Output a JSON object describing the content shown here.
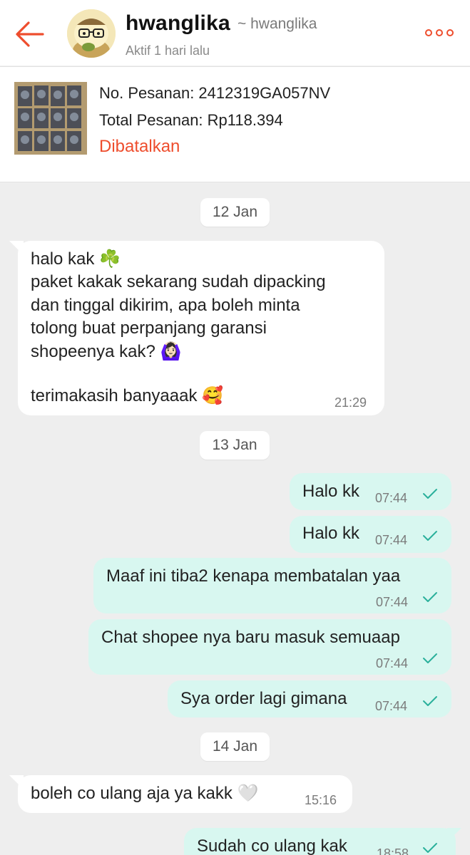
{
  "header": {
    "name": "hwanglika",
    "handle": "~ hwanglika",
    "status": "Aktif 1 hari lalu",
    "accent_color": "#ee4d2d",
    "back_icon": "arrow-left-icon",
    "more_icon": "more-dots-icon"
  },
  "order": {
    "number": "No. Pesanan: 2412319GA057NV",
    "total": "Total Pesanan: Rp118.394",
    "status": "Dibatalkan"
  },
  "messages": {
    "d1": "12 Jan",
    "m1": {
      "line1": "halo kak ☘️",
      "line2": "paket kakak sekarang sudah dipacking",
      "line3": "dan tinggal dikirim, apa boleh minta",
      "line4": "tolong buat perpanjang garansi",
      "line5": "shopeenya kak? 🙆🏻‍♀️",
      "line6": "terimakasih banyaaak 🥰",
      "time": "21:29"
    },
    "d2": "13 Jan",
    "m2": {
      "text": "Halo kk",
      "time": "07:44"
    },
    "m3": {
      "text": "Halo kk",
      "time": "07:44"
    },
    "m4": {
      "text": "Maaf ini tiba2 kenapa membatalan yaa",
      "time": "07:44"
    },
    "m5": {
      "text": "Chat shopee nya baru masuk semuaap",
      "time": "07:44"
    },
    "m6": {
      "text": "Sya order lagi gimana",
      "time": "07:44"
    },
    "d3": "14 Jan",
    "m7": {
      "text": "boleh co ulang aja ya kakk 🤍",
      "time": "15:16"
    },
    "m8": {
      "text": "Sudah co ulang kak",
      "time": "18:58"
    }
  }
}
